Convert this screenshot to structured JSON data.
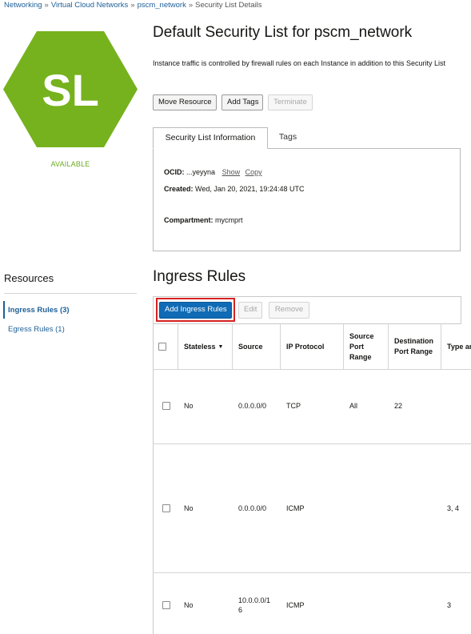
{
  "breadcrumb": {
    "items": [
      "Networking",
      "Virtual Cloud Networks",
      "pscm_network"
    ],
    "current": "Security List Details",
    "separator": "»"
  },
  "logo": {
    "initials": "SL",
    "color": "#76b21d"
  },
  "status": "AVAILABLE",
  "header": {
    "title": "Default Security List for pscm_network",
    "description": "Instance traffic is controlled by firewall rules on each Instance in addition to this Security List"
  },
  "actions": {
    "move_resource": "Move Resource",
    "add_tags": "Add Tags",
    "terminate": "Terminate"
  },
  "tabs": {
    "info": "Security List Information",
    "tags": "Tags"
  },
  "info": {
    "ocid_label": "OCID:",
    "ocid_value": "...yeyyna",
    "show": "Show",
    "copy": "Copy",
    "created_label": "Created:",
    "created_value": "Wed, Jan 20, 2021, 19:24:48 UTC",
    "compartment_label": "Compartment:",
    "compartment_value": "mycmprt"
  },
  "resources": {
    "title": "Resources",
    "items": [
      "Ingress Rules (3)",
      "Egress Rules (1)"
    ]
  },
  "ingress": {
    "title": "Ingress Rules",
    "add_button": "Add Ingress Rules",
    "edit_button": "Edit",
    "remove_button": "Remove",
    "columns": [
      "Stateless",
      "Source",
      "IP Protocol",
      "Source Port Range",
      "Destination Port Range",
      "Type an"
    ],
    "rows": [
      {
        "stateless": "No",
        "source": "0.0.0.0/0",
        "protocol": "TCP",
        "src_port": "All",
        "dst_port": "22",
        "type": ""
      },
      {
        "stateless": "No",
        "source": "0.0.0.0/0",
        "protocol": "ICMP",
        "src_port": "",
        "dst_port": "",
        "type": "3, 4"
      },
      {
        "stateless": "No",
        "source_l1": "10.0.0.0/1",
        "source_l2": "6",
        "protocol": "ICMP",
        "src_port": "",
        "dst_port": "",
        "type": "3"
      }
    ]
  },
  "colors": {
    "accent": "#1d5f97",
    "primary_button": "#0f6bb5",
    "status": "#6aab1e",
    "highlight": "#d62222"
  }
}
